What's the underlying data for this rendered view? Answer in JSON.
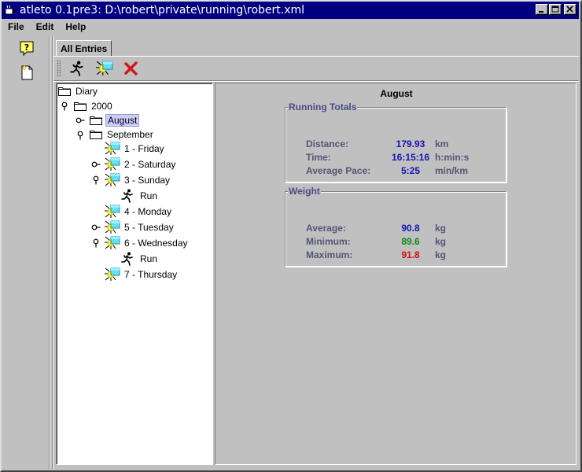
{
  "window": {
    "title": "atleto 0.1pre3: D:\\robert\\private\\running\\robert.xml"
  },
  "menu": [
    "File",
    "Edit",
    "Help"
  ],
  "tabs": {
    "active": "All Entries"
  },
  "tree": {
    "root": "Diary",
    "year": "2000",
    "august": "August",
    "september": "September",
    "days": {
      "d1": "1 - Friday",
      "d2": "2 - Saturday",
      "d3": "3 - Sunday",
      "d4": "4 - Monday",
      "d5": "5 - Tuesday",
      "d6": "6 - Wednesday",
      "d7": "7 - Thursday"
    },
    "run_label": "Run"
  },
  "detail": {
    "title": "August",
    "running": {
      "heading": "Running Totals",
      "distance_label": "Distance:",
      "distance_value": "179.93",
      "distance_unit": "km",
      "time_label": "Time:",
      "time_value": "16:15:16",
      "time_unit": "h:min:s",
      "pace_label": "Average Pace:",
      "pace_value": "5:25",
      "pace_unit": "min/km"
    },
    "weight": {
      "heading": "Weight",
      "avg_label": "Average:",
      "avg_value": "90.8",
      "avg_unit": "kg",
      "min_label": "Minimum:",
      "min_value": "89.6",
      "min_unit": "kg",
      "max_label": "Maximum:",
      "max_value": "91.8",
      "max_unit": "kg"
    }
  },
  "icons": {
    "app": "coffee-cup-icon",
    "help": "help-question-icon",
    "new_document": "new-document-icon",
    "add_run": "runner-icon",
    "add_day": "sun-day-icon",
    "delete": "delete-x-icon"
  },
  "colors": {
    "title_bar": "#000080",
    "value_blue": "#1414b4",
    "value_green": "#118811",
    "value_red": "#d01010",
    "selection": "#ccccff"
  }
}
